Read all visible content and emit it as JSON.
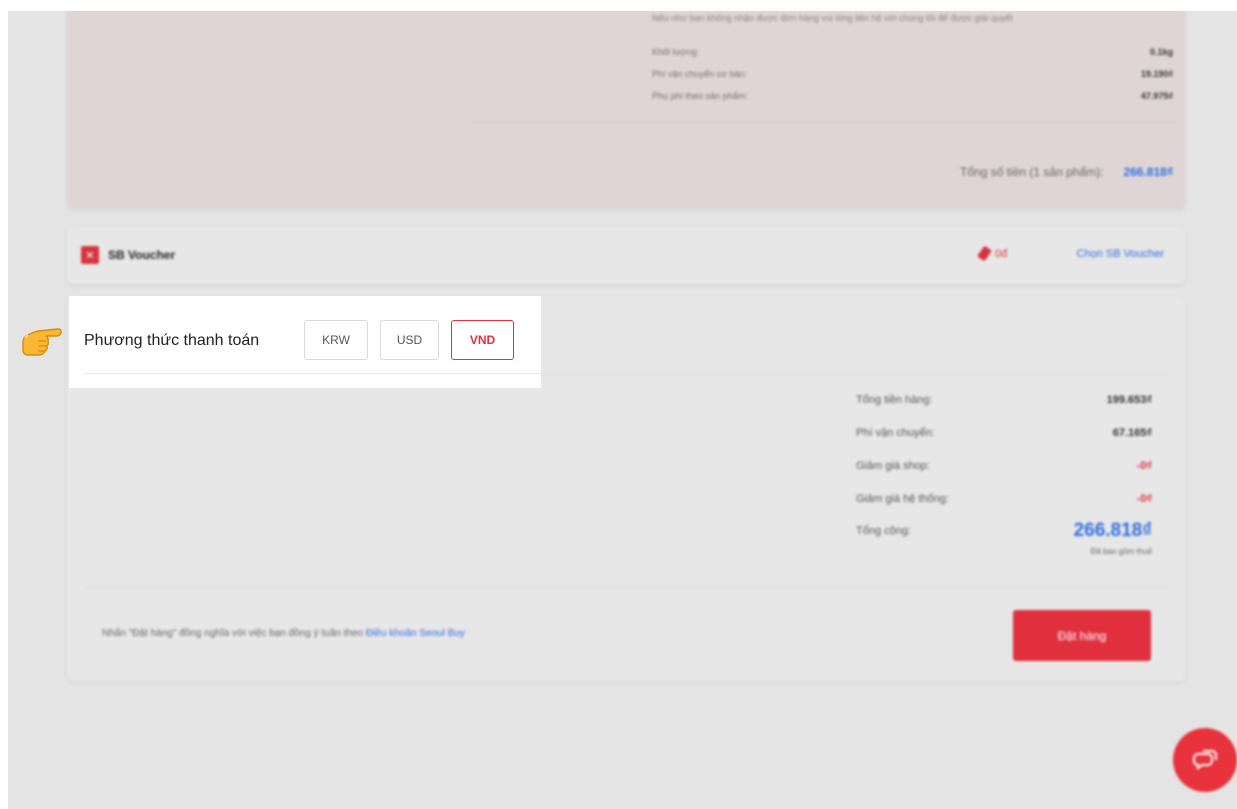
{
  "product_summary": {
    "note": "Nếu như bạn không nhận được đơn hàng vui lòng liên hệ với chúng tôi để được giải quyết",
    "fees": [
      {
        "label": "Khối lượng:",
        "value": "0.1kg"
      },
      {
        "label": "Phí vận chuyển cơ bản:",
        "value": "19.190₫"
      },
      {
        "label": "Phụ phí theo sản phẩm:",
        "value": "47.975₫"
      }
    ],
    "total_label": "Tổng số tiền (1 sản phẩm):",
    "total_value": "266.818₫"
  },
  "voucher": {
    "title": "SB Voucher",
    "discount": "0đ",
    "choose_link": "Chọn SB Voucher"
  },
  "payment": {
    "title": "Phương thức thanh toán",
    "currencies": [
      "KRW",
      "USD",
      "VND"
    ],
    "selected_currency": "VND"
  },
  "summary": {
    "rows": [
      {
        "label": "Tổng tiền hàng:",
        "value": "199.653₫"
      },
      {
        "label": "Phí vận chuyển:",
        "value": "67.165₫"
      },
      {
        "label": "Giảm giá shop:",
        "value": "-0₫"
      },
      {
        "label": "Giảm giá hệ thống:",
        "value": "-0₫"
      },
      {
        "label": "Tổng cộng:",
        "value": ""
      }
    ],
    "grand_total": "266.818₫",
    "vat_note": "Đã bao gồm thuế"
  },
  "footer": {
    "terms_text": "Nhấn \"Đặt hàng\" đồng nghĩa với việc bạn đồng ý tuân theo",
    "terms_link": "Điều khoản Seoul Buy",
    "order_button": "Đặt hàng"
  },
  "icons": {
    "pointer": "pointing-hand-icon",
    "chat": "chat-bubble-icon",
    "voucher": "voucher-logo-icon"
  },
  "colors": {
    "accent_red": "#e0303d",
    "link_blue": "#2f6ee0"
  }
}
